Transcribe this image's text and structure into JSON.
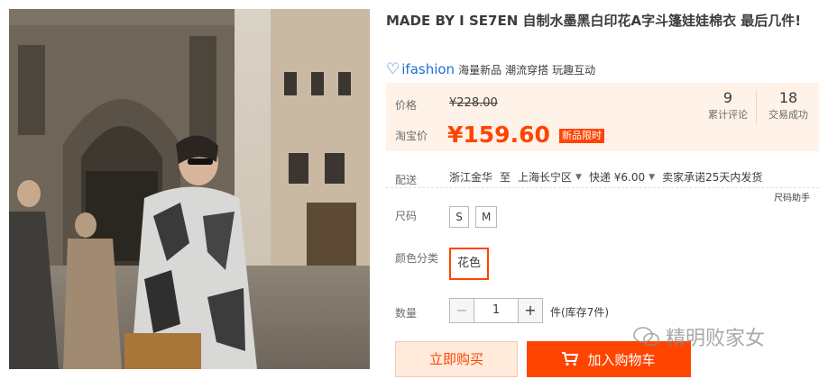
{
  "product": {
    "title": "MADE BY I SE7EN 自制水墨黑白印花A字斗篷娃娃棉衣 最后几件!"
  },
  "brand": {
    "logo_mark": "♡",
    "name": "ifashion",
    "tags": [
      "海量新品",
      "潮流穿搭",
      "玩趣互动"
    ]
  },
  "price": {
    "label": "价格",
    "original": "¥228.00",
    "taobao_label": "淘宝价",
    "current": "¥159.60",
    "badge": "新品限时"
  },
  "stats": {
    "reviews_count": "9",
    "reviews_label": "累计评论",
    "deals_count": "18",
    "deals_label": "交易成功"
  },
  "shipping": {
    "label": "配送",
    "from": "浙江金华",
    "to_word": "至",
    "to": "上海长宁区",
    "method": "快递 ¥6.00",
    "promise": "卖家承诺25天内发货",
    "size_helper": "尺码助手"
  },
  "size": {
    "label": "尺码",
    "options": [
      "S",
      "M"
    ]
  },
  "color": {
    "label": "颜色分类",
    "options": [
      "花色"
    ]
  },
  "quantity": {
    "label": "数量",
    "minus": "−",
    "value": "1",
    "plus": "+",
    "stock": "件(库存7件)"
  },
  "actions": {
    "buy_now": "立即购买",
    "add_to_cart": "加入购物车"
  },
  "watermark": {
    "text": "精明败家女"
  },
  "colors": {
    "accent": "#ff4400",
    "price_bg": "#fff2e8",
    "brand_blue": "#1e6fcf"
  }
}
